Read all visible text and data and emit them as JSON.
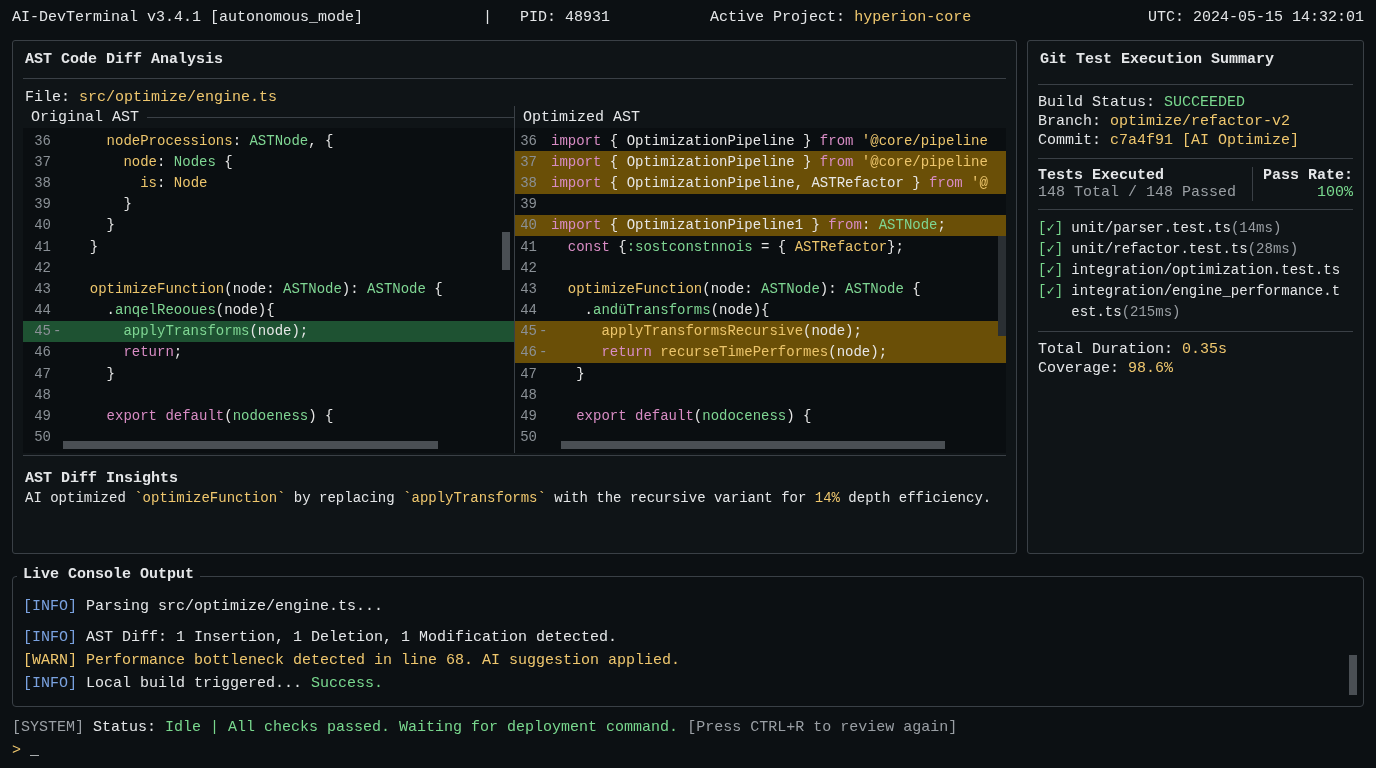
{
  "top_bar": {
    "app": "AI-DevTerminal v3.4.1 [autonomous_mode]",
    "separator": "|",
    "pid": "PID: 48931",
    "project_label": "Active Project:",
    "project": "hyperion-core",
    "clock": "UTC: 2024-05-15 14:32:01"
  },
  "diff_panel": {
    "title": "AST Code Diff Analysis",
    "file_label": "File:",
    "file": "src/optimize/engine.ts",
    "panes": [
      {
        "title": "Original AST",
        "lines": [
          {
            "num": "36",
            "kind": "context",
            "tokens": [
              {
                "text": "    nodeProcessions",
                "kind": "prop"
              },
              {
                "text": ": ",
                "kind": "plain"
              },
              {
                "text": "ASTNode",
                "kind": "type"
              },
              {
                "text": ", {",
                "kind": "plain"
              }
            ]
          },
          {
            "num": "37",
            "kind": "context",
            "tokens": [
              {
                "text": "      node",
                "kind": "prop"
              },
              {
                "text": ": ",
                "kind": "plain"
              },
              {
                "text": "Nodes",
                "kind": "type"
              },
              {
                "text": " {",
                "kind": "plain"
              }
            ]
          },
          {
            "num": "38",
            "kind": "context",
            "tokens": [
              {
                "text": "        is",
                "kind": "prop"
              },
              {
                "text": ": ",
                "kind": "plain"
              },
              {
                "text": "Node",
                "kind": "prop"
              }
            ]
          },
          {
            "num": "39",
            "kind": "context",
            "tokens": [
              {
                "text": "      }",
                "kind": "plain"
              }
            ]
          },
          {
            "num": "40",
            "kind": "context",
            "tokens": [
              {
                "text": "    }",
                "kind": "plain"
              }
            ]
          },
          {
            "num": "41",
            "kind": "context",
            "tokens": [
              {
                "text": "  }",
                "kind": "plain"
              }
            ]
          },
          {
            "num": "42",
            "kind": "context"
          },
          {
            "num": "43",
            "kind": "context",
            "tokens": [
              {
                "text": "  optimizeFunction",
                "kind": "prop"
              },
              {
                "text": "(node: ",
                "kind": "plain"
              },
              {
                "text": "ASTNode",
                "kind": "type"
              },
              {
                "text": "): ",
                "kind": "plain"
              },
              {
                "text": "ASTNode",
                "kind": "type"
              },
              {
                "text": " {",
                "kind": "plain"
              }
            ]
          },
          {
            "num": "44",
            "kind": "context",
            "tokens": [
              {
                "text": "    .",
                "kind": "plain"
              },
              {
                "text": "anqelReooues",
                "kind": "type"
              },
              {
                "text": "(node){",
                "kind": "plain"
              }
            ]
          },
          {
            "num": "45",
            "mark": "-",
            "kind": "removed",
            "tokens": [
              {
                "text": "      applyTransforms",
                "kind": "type"
              },
              {
                "text": "(node);",
                "kind": "plain"
              }
            ]
          },
          {
            "num": "46",
            "kind": "context",
            "tokens": [
              {
                "text": "      return",
                "kind": "kw"
              },
              {
                "text": ";",
                "kind": "plain"
              }
            ]
          },
          {
            "num": "47",
            "kind": "context",
            "tokens": [
              {
                "text": "    }",
                "kind": "plain"
              }
            ]
          },
          {
            "num": "48",
            "kind": "context"
          },
          {
            "num": "49",
            "kind": "context",
            "tokens": [
              {
                "text": "    export default",
                "kind": "kw"
              },
              {
                "text": "(",
                "kind": "plain"
              },
              {
                "text": "nodoeness",
                "kind": "type"
              },
              {
                "text": ") {",
                "kind": "plain"
              }
            ]
          },
          {
            "num": "50",
            "kind": "context"
          }
        ]
      },
      {
        "title": "Optimized AST",
        "lines": [
          {
            "num": "36",
            "kind": "context",
            "tokens": [
              {
                "text": "import",
                "kind": "kw"
              },
              {
                "text": " { OptimizationPipeline } ",
                "kind": "plain"
              },
              {
                "text": "from",
                "kind": "kw"
              },
              {
                "text": " '@core/pipeline",
                "kind": "prop"
              }
            ]
          },
          {
            "num": "37",
            "kind": "changed",
            "tokens": [
              {
                "text": "import",
                "kind": "kw"
              },
              {
                "text": " { OptimizationPipeline } ",
                "kind": "plain"
              },
              {
                "text": "from",
                "kind": "kw"
              },
              {
                "text": " '@core/pipeline",
                "kind": "prop"
              }
            ]
          },
          {
            "num": "38",
            "kind": "changed",
            "tokens": [
              {
                "text": "import",
                "kind": "kw"
              },
              {
                "text": " { OptimizationPipeline, ASTRefactor } ",
                "kind": "plain"
              },
              {
                "text": "from",
                "kind": "kw"
              },
              {
                "text": " '@",
                "kind": "prop"
              }
            ]
          },
          {
            "num": "39",
            "kind": "context"
          },
          {
            "num": "40",
            "kind": "changed",
            "tokens": [
              {
                "text": "import",
                "kind": "kw"
              },
              {
                "text": " { OptimizationPipeline1 } ",
                "kind": "plain"
              },
              {
                "text": "from",
                "kind": "kw"
              },
              {
                "text": ": ",
                "kind": "plain"
              },
              {
                "text": "ASTNode",
                "kind": "type"
              },
              {
                "text": ";",
                "kind": "plain"
              }
            ]
          },
          {
            "num": "41",
            "kind": "context",
            "tokens": [
              {
                "text": "  const",
                "kind": "kw"
              },
              {
                "text": " {",
                "kind": "plain"
              },
              {
                "text": ":sostconstnnois",
                "kind": "type"
              },
              {
                "text": " = { ",
                "kind": "plain"
              },
              {
                "text": "ASTRefactor",
                "kind": "prop"
              },
              {
                "text": "};",
                "kind": "plain"
              }
            ]
          },
          {
            "num": "42",
            "kind": "context"
          },
          {
            "num": "43",
            "kind": "context",
            "tokens": [
              {
                "text": "  optimizeFunction",
                "kind": "prop"
              },
              {
                "text": "(node: ",
                "kind": "plain"
              },
              {
                "text": "ASTNode",
                "kind": "type"
              },
              {
                "text": "): ",
                "kind": "plain"
              },
              {
                "text": "ASTNode",
                "kind": "type"
              },
              {
                "text": " {",
                "kind": "plain"
              }
            ]
          },
          {
            "num": "44",
            "kind": "context",
            "tokens": [
              {
                "text": "    .",
                "kind": "plain"
              },
              {
                "text": "andüTransforms",
                "kind": "type"
              },
              {
                "text": "(node){",
                "kind": "plain"
              }
            ]
          },
          {
            "num": "45",
            "mark": "-",
            "kind": "changed",
            "tokens": [
              {
                "text": "      applyTransformsRecursive",
                "kind": "prop"
              },
              {
                "text": "(node);",
                "kind": "plain"
              }
            ]
          },
          {
            "num": "46",
            "mark": "-",
            "kind": "changed",
            "tokens": [
              {
                "text": "      return ",
                "kind": "kw"
              },
              {
                "text": "recurseTimePerformes",
                "kind": "prop"
              },
              {
                "text": "(node);",
                "kind": "plain"
              }
            ]
          },
          {
            "num": "47",
            "kind": "context",
            "tokens": [
              {
                "text": "   }",
                "kind": "plain"
              }
            ]
          },
          {
            "num": "48",
            "kind": "context"
          },
          {
            "num": "49",
            "kind": "context",
            "tokens": [
              {
                "text": "   export default",
                "kind": "kw"
              },
              {
                "text": "(",
                "kind": "plain"
              },
              {
                "text": "nodoceness",
                "kind": "type"
              },
              {
                "text": ") {",
                "kind": "plain"
              }
            ]
          },
          {
            "num": "50",
            "kind": "context"
          }
        ]
      }
    ],
    "insights": {
      "title": "AST Diff Insights",
      "parts": [
        {
          "text": "AI optimized ",
          "kind": "plain"
        },
        {
          "text": "`optimizeFunction`",
          "kind": "accent"
        },
        {
          "text": " by replacing ",
          "kind": "plain"
        },
        {
          "text": "`applyTransforms`",
          "kind": "accent"
        },
        {
          "text": " with the recursive variant for ",
          "kind": "plain"
        },
        {
          "text": "14%",
          "kind": "accent"
        },
        {
          "text": " depth efficiency.",
          "kind": "plain"
        }
      ]
    }
  },
  "summary_panel": {
    "title": "Git Test Execution Summary",
    "info": [
      {
        "label": "Build Status:",
        "value": "SUCCEEDED",
        "kind": "good"
      },
      {
        "label": "Branch:",
        "value": "optimize/refactor-v2",
        "kind": "accent"
      },
      {
        "label": "Commit:",
        "value": "c7a4f91 [AI Optimize]",
        "kind": "accent"
      }
    ],
    "tests_executed": {
      "title": "Tests Executed",
      "value": "148 Total / 148 Passed"
    },
    "pass_rate": {
      "title": "Pass Rate:",
      "value": "100%"
    },
    "tests": [
      {
        "check": "[✓]",
        "passed": true,
        "name": "unit/parser.test.ts",
        "time": "(14ms)"
      },
      {
        "check": "[✓]",
        "passed": true,
        "name": "unit/refactor.test.ts",
        "time": "(28ms)"
      },
      {
        "check": "[✓]",
        "passed": true,
        "name": "integration/optimization.test.ts"
      },
      {
        "check": "[✓]",
        "passed": true,
        "name": "integration/engine_performance.test.ts",
        "time": "(215ms)"
      }
    ],
    "totals": [
      {
        "label": "Total Duration:",
        "value": "0.35s"
      },
      {
        "label": "Coverage:",
        "value": "98.6%"
      }
    ]
  },
  "console": {
    "title": "Live Console Output",
    "lines": [
      {
        "kind": "info",
        "tag": "[INFO]",
        "message": "Parsing src/optimize/engine.ts..."
      },
      {
        "kind": "info",
        "tag": "[INFO]",
        "message": "AST Diff: 1 Insertion, 1 Deletion, 1 Modification detected."
      },
      {
        "kind": "warn",
        "tag": "[WARN]",
        "message": "Performance bottleneck detected in line 68. AI suggestion applied."
      },
      {
        "kind": "info",
        "tag": "[INFO]",
        "message": "Local build triggered...",
        "result": "Success."
      }
    ]
  },
  "status_line": {
    "parts": [
      {
        "text": "[SYSTEM]",
        "kind": "dim"
      },
      {
        "text": " Status: ",
        "kind": "plain"
      },
      {
        "text": "Idle | All checks passed. Waiting for deployment command.",
        "kind": "good"
      },
      {
        "text": " [Press CTRL+R to review again]",
        "kind": "dim"
      }
    ]
  },
  "prompt": {
    "symbol": ">",
    "cursor": "_"
  }
}
